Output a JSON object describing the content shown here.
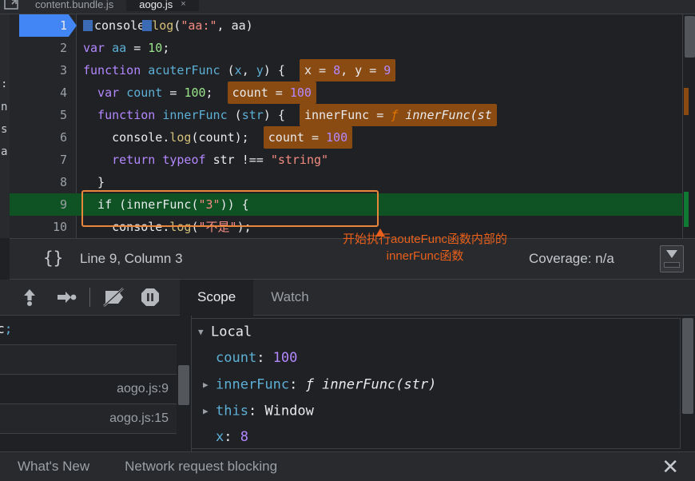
{
  "tabs": {
    "items": [
      {
        "label": "content.bundle.js",
        "active": false,
        "closable": false
      },
      {
        "label": "aogo.js",
        "active": true,
        "closable": true,
        "close_glyph": "×"
      }
    ],
    "nav_icon": "file-navigator-icon"
  },
  "left_sliver": {
    "rows": [
      "∶",
      "n'",
      "s",
      "a"
    ]
  },
  "editor": {
    "breakpoint_line": 1,
    "execution_line": 9,
    "lines": [
      {
        "num": "1",
        "tokens": [
          {
            "t": "console.",
            "c": "pl"
          },
          {
            "t": "log",
            "c": "fn"
          },
          {
            "t": "(",
            "c": "pl"
          },
          {
            "t": "\"aa:\"",
            "c": "str"
          },
          {
            "t": ", aa)",
            "c": "pl"
          }
        ]
      },
      {
        "num": "2",
        "tokens": [
          {
            "t": "var ",
            "c": "kw"
          },
          {
            "t": "aa",
            "c": "id"
          },
          {
            "t": " = ",
            "c": "pl"
          },
          {
            "t": "10",
            "c": "num"
          },
          {
            "t": ";",
            "c": "pl"
          }
        ]
      },
      {
        "num": "3",
        "tokens": [
          {
            "t": "function ",
            "c": "kw"
          },
          {
            "t": "acuterFunc",
            "c": "id"
          },
          {
            "t": " (",
            "c": "pl"
          },
          {
            "t": "x",
            "c": "id"
          },
          {
            "t": ", ",
            "c": "pl"
          },
          {
            "t": "y",
            "c": "id"
          },
          {
            "t": ") {",
            "c": "pl"
          }
        ],
        "inline": {
          "label": "x = 8, y = 9",
          "parts": [
            {
              "t": "x = ",
              "c": "pl"
            },
            {
              "t": "8",
              "c": "vnum"
            },
            {
              "t": ", y = ",
              "c": "pl"
            },
            {
              "t": "9",
              "c": "vnum"
            }
          ]
        }
      },
      {
        "num": "4",
        "tokens": [
          {
            "t": "  var ",
            "c": "kw"
          },
          {
            "t": "count",
            "c": "id"
          },
          {
            "t": " = ",
            "c": "pl"
          },
          {
            "t": "100",
            "c": "num"
          },
          {
            "t": ";",
            "c": "pl"
          }
        ],
        "inline": {
          "label": "count = 100",
          "parts": [
            {
              "t": "count = ",
              "c": "pl"
            },
            {
              "t": "100",
              "c": "vnum"
            }
          ]
        }
      },
      {
        "num": "5",
        "tokens": [
          {
            "t": "  function ",
            "c": "kw"
          },
          {
            "t": "innerFunc",
            "c": "id"
          },
          {
            "t": " (",
            "c": "pl"
          },
          {
            "t": "str",
            "c": "id"
          },
          {
            "t": ") {",
            "c": "pl"
          }
        ],
        "inline": {
          "label": "innerFunc = f innerFunc(st",
          "parts": [
            {
              "t": "innerFunc = ",
              "c": "pl"
            },
            {
              "t": "ƒ ",
              "c": "forange"
            },
            {
              "t": "innerFunc(st",
              "c": "ital"
            }
          ]
        }
      },
      {
        "num": "6",
        "tokens": [
          {
            "t": "    console.",
            "c": "pl"
          },
          {
            "t": "log",
            "c": "fn"
          },
          {
            "t": "(count);",
            "c": "pl"
          }
        ],
        "inline": {
          "label": "count = 100",
          "parts": [
            {
              "t": "count = ",
              "c": "pl"
            },
            {
              "t": "100",
              "c": "vnum"
            }
          ]
        }
      },
      {
        "num": "7",
        "tokens": [
          {
            "t": "    return ",
            "c": "kw"
          },
          {
            "t": "typeof ",
            "c": "kw"
          },
          {
            "t": "str ",
            "c": "pl"
          },
          {
            "t": "!== ",
            "c": "pl"
          },
          {
            "t": "\"string\"",
            "c": "str"
          }
        ]
      },
      {
        "num": "8",
        "tokens": [
          {
            "t": "  }",
            "c": "pl"
          }
        ]
      },
      {
        "num": "9",
        "tokens": [
          {
            "t": "  if",
            "c": "pl"
          },
          {
            "t": " (innerFunc(",
            "c": "pl"
          },
          {
            "t": "\"3\"",
            "c": "str"
          },
          {
            "t": ")) {",
            "c": "pl"
          }
        ]
      },
      {
        "num": "10",
        "tokens": [
          {
            "t": "    console.",
            "c": "pl"
          },
          {
            "t": "log",
            "c": "fn"
          },
          {
            "t": "(",
            "c": "pl"
          },
          {
            "t": "\"不是\"",
            "c": "str"
          },
          {
            "t": ");",
            "c": "pl"
          }
        ]
      }
    ]
  },
  "annotation": {
    "line1": "开始执行aouteFunc函数内部的",
    "line2": "innerFunc函数",
    "color": "#e8601c"
  },
  "statusbar": {
    "format_label": "{}",
    "position": "Line 9, Column 3",
    "coverage": "Coverage: n/a"
  },
  "debugger_toolbar": {
    "buttons": [
      {
        "name": "step-out-icon",
        "title": "Step out"
      },
      {
        "name": "step-icon",
        "title": "Step"
      },
      {
        "name": "deactivate-breakpoints-icon",
        "title": "Deactivate breakpoints"
      },
      {
        "name": "pause-on-exceptions-icon",
        "title": "Pause on exceptions"
      }
    ]
  },
  "panel_tabs": {
    "items": [
      {
        "label": "Scope",
        "active": true
      },
      {
        "label": "Watch",
        "active": false
      }
    ]
  },
  "console_left": {
    "rows": [
      {
        "text": "erFunc",
        "semi": ";",
        "link": ""
      },
      {
        "text": "",
        "semi": "",
        "link": ""
      },
      {
        "text": "",
        "semi": "",
        "link": "aogo.js:9"
      },
      {
        "text": "",
        "semi": "",
        "link": "aogo.js:15"
      }
    ]
  },
  "scope": {
    "rows": [
      {
        "arrow": "▼",
        "name": "Local",
        "sep": "",
        "value": "",
        "value_class": "sc-win",
        "indent": 8,
        "is_group": true
      },
      {
        "arrow": "",
        "name": "count",
        "sep": ":",
        "value": "100",
        "value_class": "sc-num",
        "indent": 30,
        "is_group": false
      },
      {
        "arrow": "▶",
        "name": "innerFunc",
        "sep": ":",
        "value": "ƒ innerFunc(str)",
        "value_class": "sc-fn",
        "indent": 14,
        "is_group": false
      },
      {
        "arrow": "▶",
        "name": "this",
        "sep": ":",
        "value": "Window",
        "value_class": "sc-win",
        "indent": 14,
        "is_group": false
      },
      {
        "arrow": "",
        "name": "x",
        "sep": ":",
        "value": "8",
        "value_class": "sc-num",
        "indent": 30,
        "is_group": false
      }
    ]
  },
  "drawer": {
    "tabs": [
      {
        "label": "What's New"
      },
      {
        "label": "Network request blocking"
      }
    ],
    "close_glyph": "✕"
  }
}
